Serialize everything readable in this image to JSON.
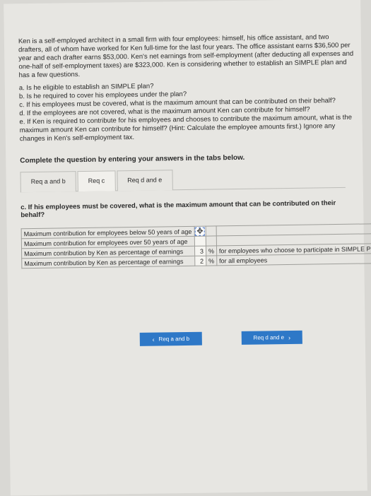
{
  "problem": {
    "intro": "Ken is a self-employed architect in a small firm with four employees: himself, his office assistant, and two drafters, all of whom have worked for Ken full-time for the last four years. The office assistant earns $36,500 per year and each drafter earns $53,000. Ken's net earnings from self-employment (after deducting all expenses and one-half of self-employment taxes) are $323,000. Ken is considering whether to establish an SIMPLE plan and has a few questions.",
    "questions": [
      "a. Is he eligible to establish an SIMPLE plan?",
      "b. Is he required to cover his employees under the plan?",
      "c. If his employees must be covered, what is the maximum amount that can be contributed on their behalf?",
      "d. If the employees are not covered, what is the maximum amount Ken can contribute for himself?",
      "e. If Ken is required to contribute for his employees and chooses to contribute the maximum amount, what is the maximum amount Ken can contribute for himself? (Hint: Calculate the employee amounts first.) Ignore any changes in Ken's self-employment tax."
    ]
  },
  "instruction": "Complete the question by entering your answers in the tabs below.",
  "tabs": [
    {
      "label": "Req a and b"
    },
    {
      "label": "Req c"
    },
    {
      "label": "Req d and e"
    }
  ],
  "question_c": "c. If his employees must be covered, what is the maximum amount that can be contributed on their behalf?",
  "rows": [
    {
      "label": "Maximum contribution for employees below 50 years of age",
      "value": "",
      "unit": "",
      "note": ""
    },
    {
      "label": "Maximum contribution for employees over 50 years of age",
      "value": "",
      "unit": "",
      "note": ""
    },
    {
      "label": "Maximum contribution by Ken as percentage of earnings",
      "value": "3",
      "unit": "%",
      "note": "for employees who choose to participate in SIMPLE Plan"
    },
    {
      "label": "Maximum contribution by Ken as percentage of earnings",
      "value": "2",
      "unit": "%",
      "note": "for all employees"
    }
  ],
  "nav": {
    "prev_label": "Req a and b",
    "next_label": "Req d and e"
  }
}
